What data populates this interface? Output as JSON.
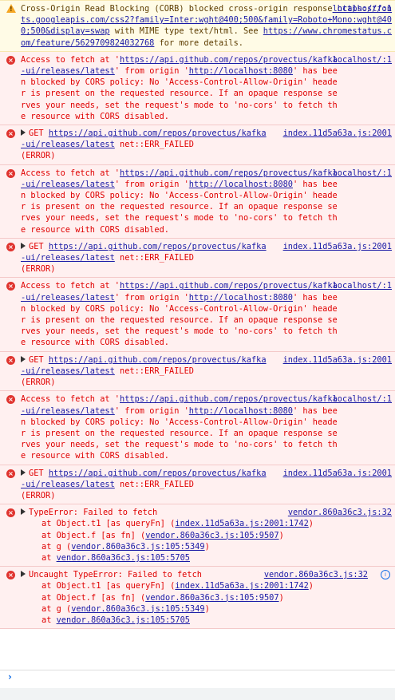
{
  "warning": {
    "text_pre": "Cross-Origin Read Blocking (CORB) blocked cross-origin response ",
    "url": "https://fonts.googleapis.com/css2?family=Inter:wght@400;500&family=Roboto+Mono:wght@400;500&display=swap",
    "text_mid": " with MIME type text/html. See ",
    "url2": "https://www.chromestatus.com/feature/5629709824032768",
    "text_post": " for more details.",
    "source": "localhost/:1"
  },
  "cors_error": {
    "part1": "Access to fetch at '",
    "url": "https://api.github.com/repos/provectus/kafka-ui/releases/latest",
    "part2": "' from origin '",
    "origin": "http://localhost:8080",
    "part3": "' has been blocked by CORS policy: No 'Access-Control-Allow-Origin' header is present on the requested resource. If an opaque response serves your needs, set the request's mode to 'no-cors' to fetch the resource with CORS disabled.",
    "source": "localhost/:1"
  },
  "get_error": {
    "method": "GET",
    "url": "https://api.github.com/repos/provectus/kafka-ui/releases/latest",
    "status": " net::ERR_FAILED",
    "tail": "(ERROR)",
    "source": "index.11d5a63a.js:2001"
  },
  "type_error": {
    "title": "TypeError: Failed to fetch",
    "source": "vendor.860a36c3.js:32",
    "frames": [
      {
        "prefix": "at Object.t1 [as queryFn] (",
        "link": "index.11d5a63a.js:2001:1742",
        "suffix": ")"
      },
      {
        "prefix": "at Object.f [as fn] (",
        "link": "vendor.860a36c3.js:105:9507",
        "suffix": ")"
      },
      {
        "prefix": "at g (",
        "link": "vendor.860a36c3.js:105:5349",
        "suffix": ")"
      },
      {
        "prefix": "at ",
        "link": "vendor.860a36c3.js:105:5705",
        "suffix": ""
      }
    ]
  },
  "uncaught_error": {
    "title": "Uncaught TypeError: Failed to fetch",
    "source": "vendor.860a36c3.js:32",
    "frames": [
      {
        "prefix": "at Object.t1 [as queryFn] (",
        "link": "index.11d5a63a.js:2001:1742",
        "suffix": ")"
      },
      {
        "prefix": "at Object.f [as fn] (",
        "link": "vendor.860a36c3.js:105:9507",
        "suffix": ")"
      },
      {
        "prefix": "at g (",
        "link": "vendor.860a36c3.js:105:5349",
        "suffix": ")"
      },
      {
        "prefix": "at ",
        "link": "vendor.860a36c3.js:105:5705",
        "suffix": ""
      }
    ]
  },
  "prompt": {
    "chevron": "›"
  },
  "icons": {
    "error": "error-circle-icon",
    "warning": "warning-triangle-icon",
    "info": "info-icon"
  }
}
